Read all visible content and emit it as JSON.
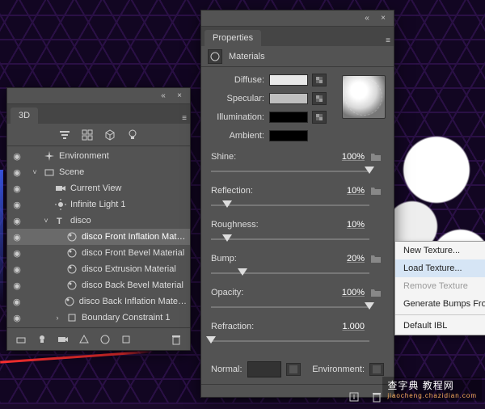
{
  "panel_3d": {
    "title": "3D",
    "toolbar_icons": [
      "filter-icon",
      "grid-icon",
      "cube-icon",
      "lightbulb-icon"
    ],
    "tree": [
      {
        "eye": true,
        "exp": "",
        "icon": "sparkle",
        "label": "Environment",
        "indent": 0
      },
      {
        "eye": true,
        "exp": "v",
        "icon": "scene",
        "label": "Scene",
        "indent": 0
      },
      {
        "eye": true,
        "exp": "",
        "icon": "camera",
        "label": "Current View",
        "indent": 1
      },
      {
        "eye": true,
        "exp": "",
        "icon": "sun",
        "label": "Infinite Light 1",
        "indent": 1
      },
      {
        "eye": true,
        "exp": "v",
        "icon": "text3d",
        "label": "disco",
        "indent": 1
      },
      {
        "eye": true,
        "exp": "",
        "icon": "material",
        "label": "disco Front Inflation Mat…",
        "indent": 2,
        "sel": true
      },
      {
        "eye": true,
        "exp": "",
        "icon": "material",
        "label": "disco Front Bevel Material",
        "indent": 2
      },
      {
        "eye": true,
        "exp": "",
        "icon": "material",
        "label": "disco Extrusion Material",
        "indent": 2
      },
      {
        "eye": true,
        "exp": "",
        "icon": "material",
        "label": "disco Back Bevel Material",
        "indent": 2
      },
      {
        "eye": true,
        "exp": "",
        "icon": "material",
        "label": "disco Back Inflation Mate…",
        "indent": 2
      },
      {
        "eye": true,
        "exp": ">",
        "icon": "constraint",
        "label": "Boundary Constraint 1",
        "indent": 2
      }
    ],
    "footer_icons": [
      "plane-icon",
      "lightbulb-icon",
      "camera-icon",
      "mesh-icon",
      "material-icon",
      "constraint-icon",
      "trash-icon"
    ]
  },
  "panel_props": {
    "title": "Properties",
    "subtitle": "Materials",
    "color_rows": [
      {
        "label": "Diffuse:",
        "cls": "diff-sw",
        "tex": true
      },
      {
        "label": "Specular:",
        "cls": "spec-sw",
        "tex": true
      },
      {
        "label": "Illumination:",
        "cls": "ill-sw",
        "tex": true
      },
      {
        "label": "Ambient:",
        "cls": "amb-sw",
        "tex": false
      }
    ],
    "params": [
      {
        "name": "Shine:",
        "value": "100%",
        "thumb": 100,
        "folder": true
      },
      {
        "name": "Reflection:",
        "value": "10%",
        "thumb": 10,
        "folder": true
      },
      {
        "name": "Roughness:",
        "value": "10%",
        "thumb": 10,
        "folder": false
      },
      {
        "name": "Bump:",
        "value": "20%",
        "thumb": 20,
        "folder": true
      },
      {
        "name": "Opacity:",
        "value": "100%",
        "thumb": 100,
        "folder": true
      },
      {
        "name": "Refraction:",
        "value": "1.000",
        "thumb": 0,
        "folder": false
      }
    ],
    "normal_label": "Normal:",
    "env_label": "Environment:"
  },
  "context_menu": {
    "items": [
      {
        "label": "New Texture...",
        "state": "normal"
      },
      {
        "label": "Load Texture...",
        "state": "hover"
      },
      {
        "label": "Remove Texture",
        "state": "disabled"
      },
      {
        "label": "Generate Bumps From",
        "state": "normal",
        "truncated": true
      }
    ],
    "footer_item": "Default IBL"
  },
  "watermark": {
    "main": "查字典 教程网",
    "sub": "jiaocheng.chazidian.com"
  }
}
